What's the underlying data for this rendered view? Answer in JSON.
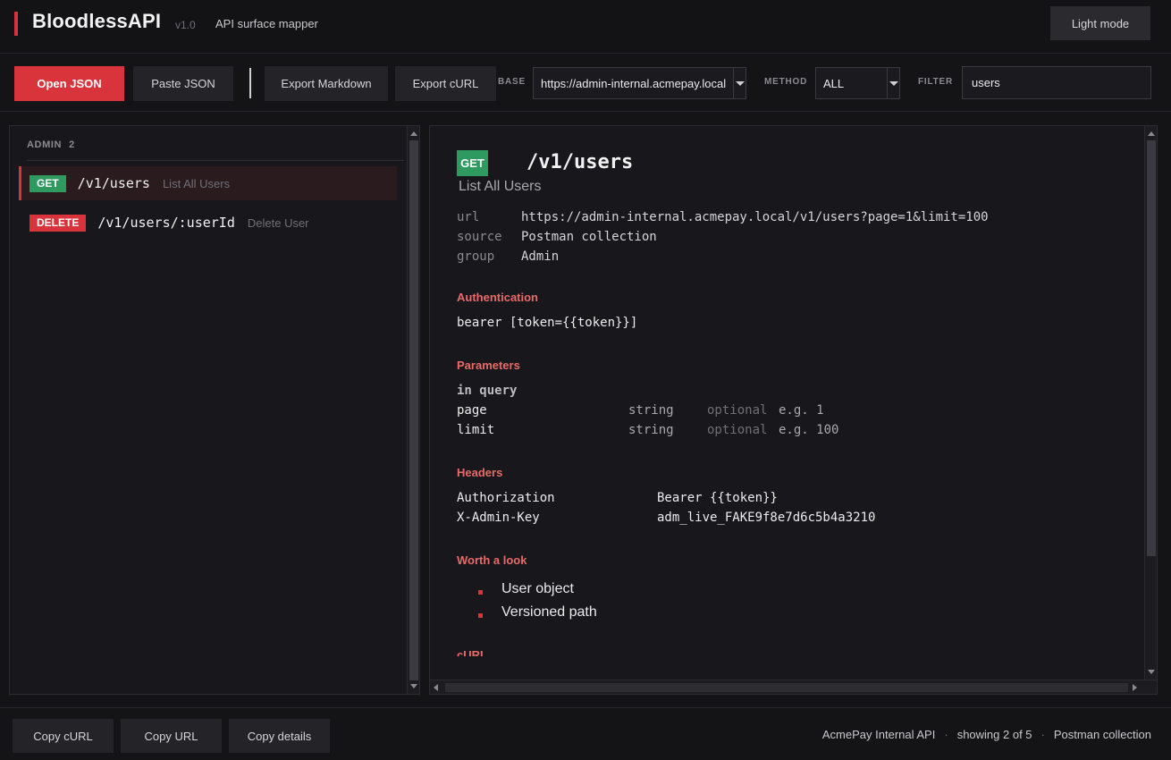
{
  "header": {
    "brand": "BloodlessAPI",
    "version": "v1.0",
    "tagline": "API surface mapper",
    "light_mode_label": "Light mode"
  },
  "toolbar": {
    "open_json": "Open JSON",
    "paste_json": "Paste JSON",
    "export_markdown": "Export Markdown",
    "export_curl": "Export cURL",
    "base_label": "BASE",
    "base_value": "https://admin-internal.acmepay.local",
    "method_label": "METHOD",
    "method_value": "ALL",
    "filter_label": "FILTER",
    "filter_value": "users"
  },
  "sidebar": {
    "group_name": "ADMIN",
    "group_count": "2",
    "endpoints": [
      {
        "method": "GET",
        "path": "/v1/users",
        "name": "List All Users",
        "active": true
      },
      {
        "method": "DELETE",
        "path": "/v1/users/:userId",
        "name": "Delete User",
        "active": false
      }
    ]
  },
  "detail": {
    "method": "GET",
    "path": "/v1/users",
    "title": "List All Users",
    "meta": [
      {
        "key": "url",
        "value": "https://admin-internal.acmepay.local/v1/users?page=1&limit=100"
      },
      {
        "key": "source",
        "value": "Postman collection"
      },
      {
        "key": "group",
        "value": "Admin"
      }
    ],
    "auth_title": "Authentication",
    "auth_value": "bearer [token={{token}}]",
    "params_title": "Parameters",
    "params_location": "in query",
    "params": [
      {
        "name": "page",
        "type": "string",
        "req": "optional",
        "example": "e.g. 1"
      },
      {
        "name": "limit",
        "type": "string",
        "req": "optional",
        "example": "e.g. 100"
      }
    ],
    "headers_title": "Headers",
    "headers": [
      {
        "name": "Authorization",
        "value": "Bearer {{token}}"
      },
      {
        "name": "X-Admin-Key",
        "value": "adm_live_FAKE9f8e7d6c5b4a3210"
      }
    ],
    "look_title": "Worth a look",
    "look_items": [
      "User object",
      "Versioned path"
    ],
    "curl_title": "cURL"
  },
  "footer": {
    "copy_curl": "Copy cURL",
    "copy_url": "Copy URL",
    "copy_details": "Copy details",
    "collection": "AcmePay Internal API",
    "sep": "·",
    "showing": "showing 2 of 5",
    "source": "Postman collection"
  },
  "colors": {
    "accent": "#d9343c",
    "get": "#2f9a5f",
    "section": "#e86a6a"
  }
}
